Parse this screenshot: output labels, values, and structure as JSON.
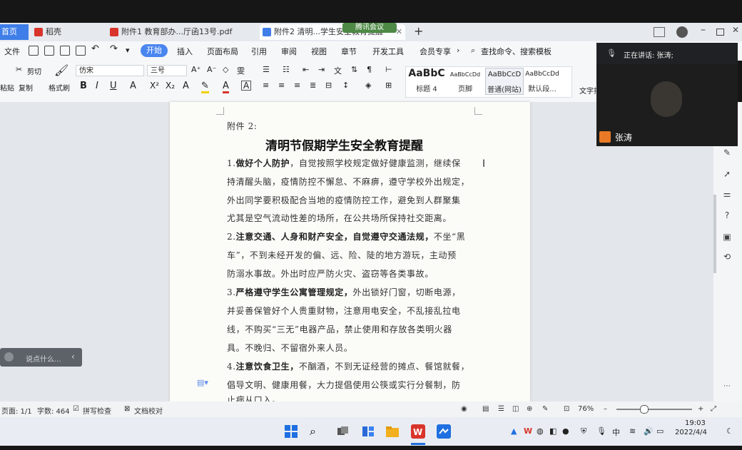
{
  "tabs": {
    "home": "首页",
    "daoke": "稻壳",
    "file1": "附件1 教育部办...厅函13号.pdf",
    "file2": "附件2 清明...学生安全教育提醒",
    "meeting": "腾讯会议",
    "new_tab": "+"
  },
  "menu": {
    "file": "文件",
    "start": "开始",
    "insert": "插入",
    "layout": "页面布局",
    "references": "引用",
    "review": "审阅",
    "view": "视图",
    "chapter": "章节",
    "devtools": "开发工具",
    "member": "会员专享",
    "search": "查找命令、搜索模板"
  },
  "ribbon": {
    "cut": "剪切",
    "paste": "粘贴",
    "copy": "复制",
    "format_painter": "格式刷",
    "font": "仿宋",
    "size": "三号",
    "styles": [
      {
        "preview": "AaBbC",
        "label": "标题 4"
      },
      {
        "preview": "AaBbCcDd",
        "label": "页脚"
      },
      {
        "preview": "AaBbCcD",
        "label": "普通(网站)"
      },
      {
        "preview": "AaBbCcDd",
        "label": "默认段..."
      }
    ],
    "text_tool": "文字排"
  },
  "document": {
    "header": "附件 2:",
    "title": "清明节假期学生安全教育提醒",
    "p1": {
      "bold": "做好个人防护",
      "lead": "1.",
      "rest": "，自觉按照学校规定做好健康监测，继续保"
    },
    "p1_lines": [
      "持清醒头脑，疫情防控不懈怠、不麻痹，遵守学校外出规定，",
      "外出同学要积极配合当地的疫情防控工作，避免到人群聚集",
      "尤其是空气流动性差的场所，在公共场所保持社交距离。"
    ],
    "p2": {
      "lead": "2.",
      "bold": "注意交通、人身和财产安全，自觉遵守交通法规，",
      "rest": "不坐“黑"
    },
    "p2_lines": [
      "车”，不到未经开发的偏、远、险、陡的地方游玩，主动预",
      "防溺水事故。外出时应严防火灾、盗窃等各类事故。"
    ],
    "p3": {
      "lead": "3.",
      "bold": "严格遵守学生公寓管理规定，",
      "rest": "外出锁好门窗，切断电源，"
    },
    "p3_lines": [
      "并妥善保管好个人贵重财物，注意用电安全，不乱接乱拉电",
      "线，不购买“三无”电器产品，禁止使用和存放各类明火器",
      "具。不晚归、不留宿外来人员。"
    ],
    "p4": {
      "lead": "4.",
      "bold": "注意饮食卫生，",
      "rest": "不酗酒，不到无证经营的摊点、餐馆就餐，"
    },
    "p4_lines": [
      "倡导文明、健康用餐，大力提倡使用公筷或实行分餐制，防",
      "止病从口入。"
    ]
  },
  "meeting_overlay": {
    "speaking": "正在讲话: 张涛;",
    "participant": "张涛"
  },
  "chat_box": {
    "placeholder": "说点什么..."
  },
  "statusbar": {
    "page": "页面: 1/1",
    "words": "字数: 464",
    "spell": "拼写检查",
    "proof": "文档校对",
    "zoom": "76%"
  },
  "taskbar": {
    "ime": "中",
    "time": "19:03",
    "date": "2022/4/4"
  },
  "colors": {
    "accent": "#4a86f0",
    "wps_red": "#d9342b",
    "page": "#fbfbf8"
  }
}
